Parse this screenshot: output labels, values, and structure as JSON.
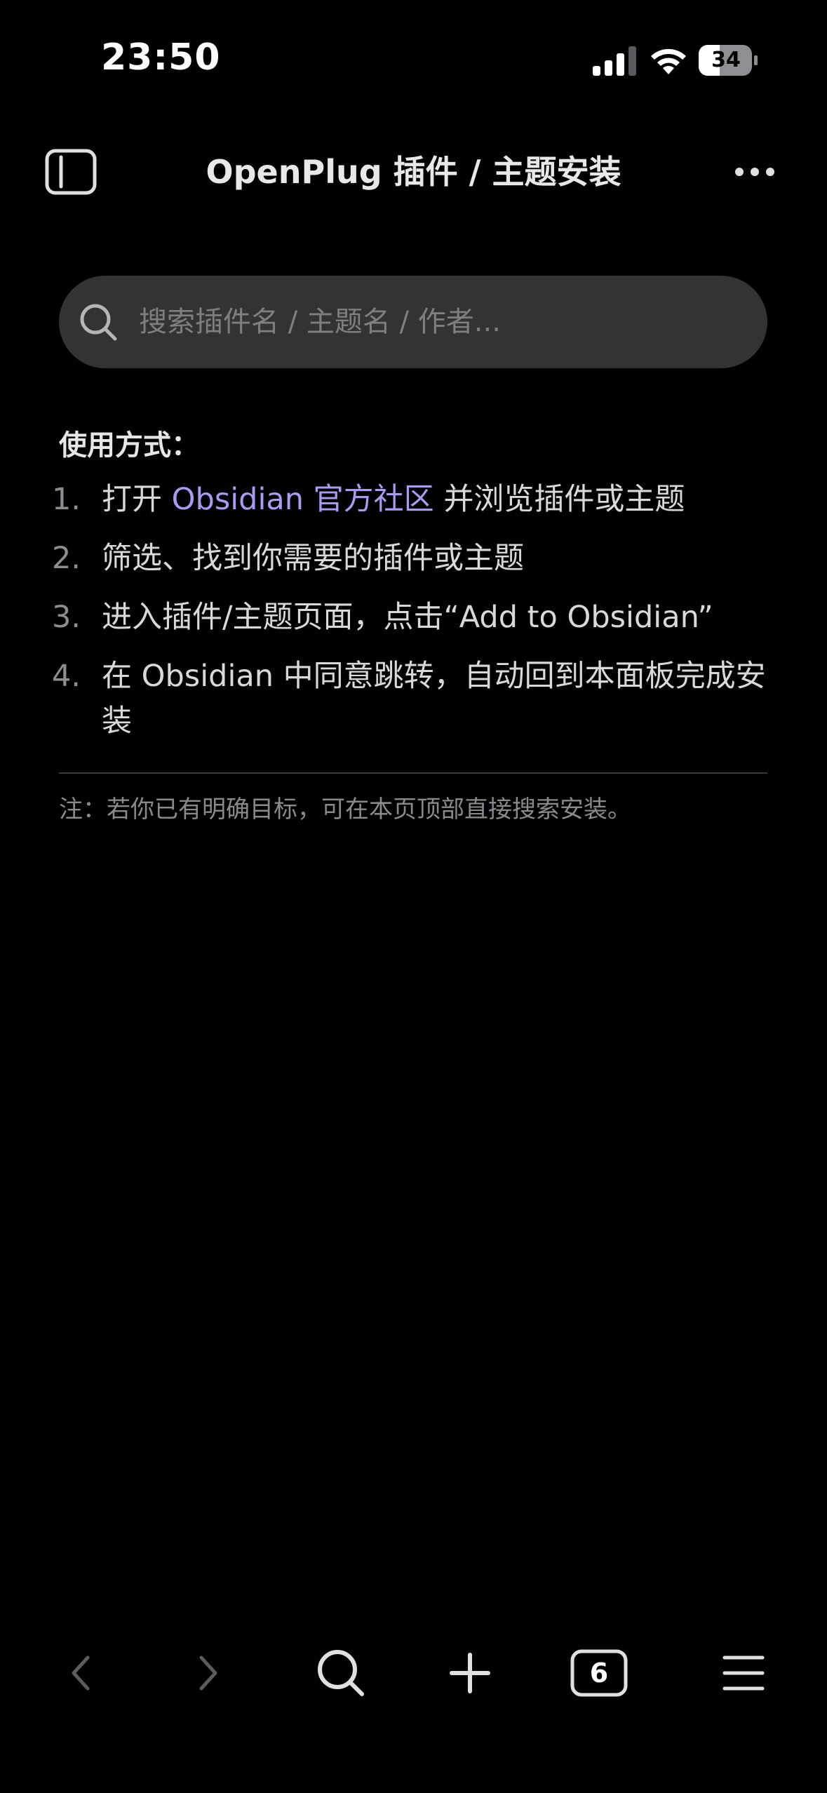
{
  "status_bar": {
    "time": "23:50",
    "battery": "34"
  },
  "nav": {
    "title": "OpenPlug 插件 / 主题安装"
  },
  "search": {
    "placeholder": "搜索插件名 / 主题名 / 作者..."
  },
  "usage": {
    "heading": "使用方式：",
    "steps": [
      {
        "num": "1.",
        "before": "打开 ",
        "link": "Obsidian 官方社区",
        "after": " 并浏览插件或主题"
      },
      {
        "num": "2.",
        "text": "筛选、找到你需要的插件或主题"
      },
      {
        "num": "3.",
        "text": "进入插件/主题页面，点击“Add to Obsidian”"
      },
      {
        "num": "4.",
        "text": "在 Obsidian 中同意跳转，自动回到本面板完成安装"
      }
    ],
    "note": "注：若你已有明确目标，可在本页顶部直接搜索安装。"
  },
  "toolbar": {
    "tab_count": "6"
  },
  "colors": {
    "background": "#000000",
    "link": "#a99bf0",
    "search_bg": "#333335"
  }
}
